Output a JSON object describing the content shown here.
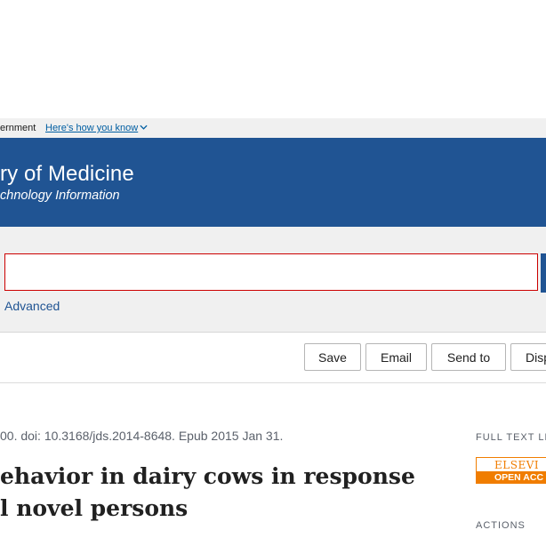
{
  "gov_banner": {
    "text": "ernment",
    "link": "Here's how you know"
  },
  "header": {
    "title": "ry of Medicine",
    "subtitle": "chnology Information"
  },
  "search": {
    "value": "",
    "advanced_label": "Advanced"
  },
  "toolbar": {
    "save_label": "Save",
    "email_label": "Email",
    "send_to_label": "Send to",
    "display_label": "Disp"
  },
  "article": {
    "citation": "00. doi: 10.3168/jds.2014-8648. Epub 2015 Jan 31.",
    "title": "ehavior in dairy cows in response l novel persons"
  },
  "sidebar": {
    "full_text_heading": "FULL TEXT LIN",
    "publisher_name": "ELSEVI",
    "open_access_label": "OPEN ACC",
    "actions_heading": "ACTIONS"
  },
  "colors": {
    "header_blue": "#205493",
    "link_blue": "#005ea2",
    "elsevier_orange": "#f07d00",
    "search_border_red": "#cc0000"
  }
}
